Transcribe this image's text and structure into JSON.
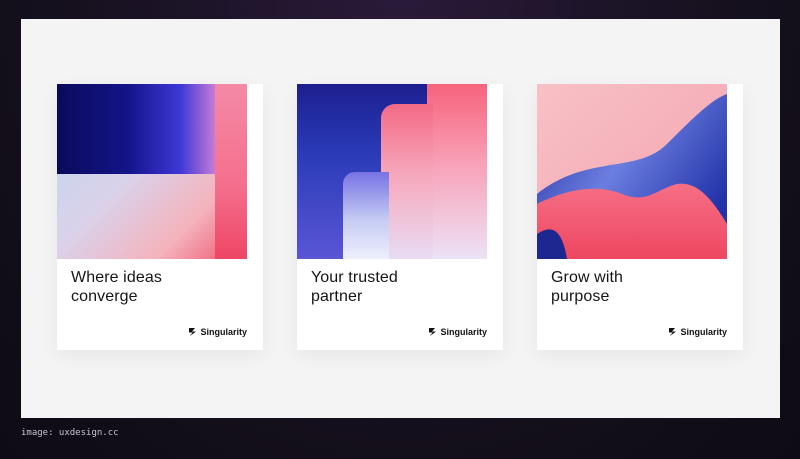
{
  "cards": [
    {
      "title": "Where ideas\nconverge",
      "brand": "Singularity"
    },
    {
      "title": "Your trusted\npartner",
      "brand": "Singularity"
    },
    {
      "title": "Grow with\npurpose",
      "brand": "Singularity"
    }
  ],
  "caption": "image: uxdesign.cc"
}
